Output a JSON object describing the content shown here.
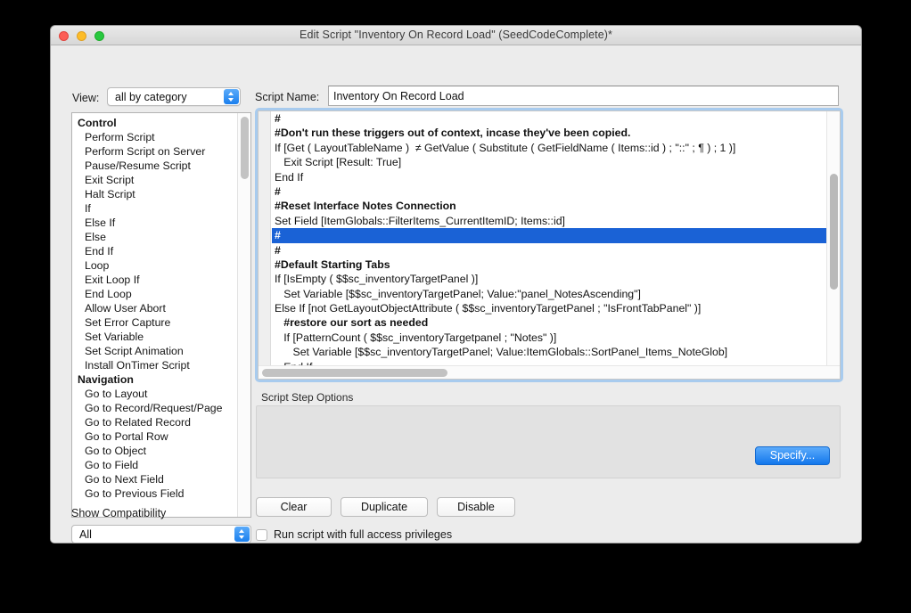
{
  "window": {
    "title": "Edit Script \"Inventory On Record Load\" (SeedCodeComplete)*",
    "traffic_lights": {
      "close": "close-button",
      "minimize": "minimize-button",
      "maximize": "maximize-button"
    },
    "colors": {
      "close": "#fc5d55",
      "minimize": "#fdbc28",
      "maximize": "#28c83f",
      "accent_blue": "#1277ec",
      "selection_blue": "#1a62d6",
      "focus_ring": "#a8cbee",
      "window_bg": "#ececec"
    }
  },
  "toolbar": {
    "view_label": "View:",
    "view_value": "all by category",
    "script_name_label": "Script Name:",
    "script_name_value": "Inventory On Record Load",
    "script_name_placeholder": "Script Name"
  },
  "steps_panel": {
    "categories": [
      {
        "name": "Control",
        "items": [
          "Perform Script",
          "Perform Script on Server",
          "Pause/Resume Script",
          "Exit Script",
          "Halt Script",
          "If",
          "Else If",
          "Else",
          "End If",
          "Loop",
          "Exit Loop If",
          "End Loop",
          "Allow User Abort",
          "Set Error Capture",
          "Set Variable",
          "Set Script Animation",
          "Install OnTimer Script"
        ]
      },
      {
        "name": "Navigation",
        "items": [
          "Go to Layout",
          "Go to Record/Request/Page",
          "Go to Related Record",
          "Go to Portal Row",
          "Go to Object",
          "Go to Field",
          "Go to Next Field",
          "Go to Previous Field"
        ]
      }
    ]
  },
  "compatibility": {
    "label": "Show Compatibility",
    "value": "All"
  },
  "script_editor": {
    "lines": [
      {
        "text": "#",
        "comment": true,
        "selected": false
      },
      {
        "text": "#Don't run these triggers out of context, incase they've been copied.",
        "comment": true,
        "selected": false
      },
      {
        "text": "If [Get ( LayoutTableName )  ≠ GetValue ( Substitute ( GetFieldName ( Items::id ) ; \"::\" ; ¶ ) ; 1 )]",
        "comment": false,
        "selected": false
      },
      {
        "text": "   Exit Script [Result: True]",
        "comment": false,
        "selected": false
      },
      {
        "text": "End If",
        "comment": false,
        "selected": false
      },
      {
        "text": "#",
        "comment": true,
        "selected": false
      },
      {
        "text": "#Reset Interface Notes Connection",
        "comment": true,
        "selected": false
      },
      {
        "text": "Set Field [ItemGlobals::FilterItems_CurrentItemID; Items::id]",
        "comment": false,
        "selected": false
      },
      {
        "text": "#",
        "comment": true,
        "selected": true
      },
      {
        "text": "#",
        "comment": true,
        "selected": false
      },
      {
        "text": "#Default Starting Tabs",
        "comment": true,
        "selected": false
      },
      {
        "text": "If [IsEmpty ( $$sc_inventoryTargetPanel )]",
        "comment": false,
        "selected": false
      },
      {
        "text": "   Set Variable [$$sc_inventoryTargetPanel; Value:\"panel_NotesAscending\"]",
        "comment": false,
        "selected": false
      },
      {
        "text": "Else If [not GetLayoutObjectAttribute ( $$sc_inventoryTargetPanel ; \"IsFrontTabPanel\" )]",
        "comment": false,
        "selected": false
      },
      {
        "text": "   #restore our sort as needed",
        "comment": true,
        "selected": false
      },
      {
        "text": "   If [PatternCount ( $$sc_inventoryTargetpanel ; \"Notes\" )]",
        "comment": false,
        "selected": false
      },
      {
        "text": "      Set Variable [$$sc_inventoryTargetPanel; Value:ItemGlobals::SortPanel_Items_NoteGlob]",
        "comment": false,
        "selected": false
      },
      {
        "text": "   End If",
        "comment": false,
        "selected": false
      }
    ]
  },
  "options": {
    "label": "Script Step Options",
    "specify_label": "Specify..."
  },
  "actions": {
    "clear": "Clear",
    "duplicate": "Duplicate",
    "disable": "Disable"
  },
  "full_access": {
    "label": "Run script with full access privileges",
    "checked": false
  }
}
